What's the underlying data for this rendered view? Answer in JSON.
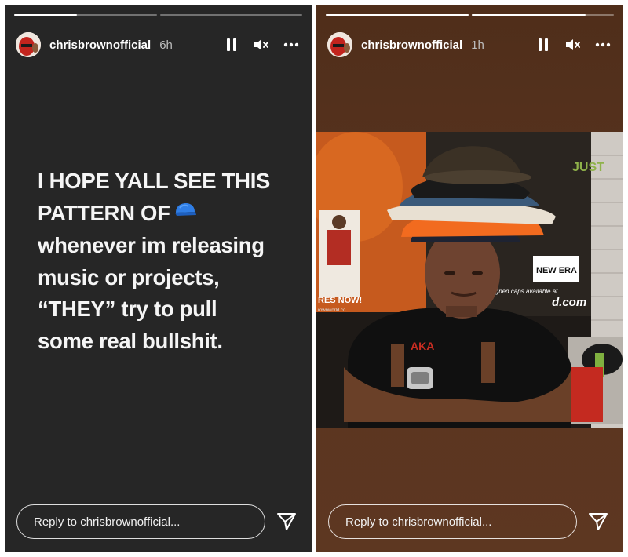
{
  "stories": [
    {
      "progress": [
        0.44,
        0.0
      ],
      "username": "chrisbrownofficial",
      "time_ago": "6h",
      "controls": {
        "pause_icon": "pause-icon",
        "mute_icon": "speaker-muted-icon",
        "more_icon": "more-horizontal-icon"
      },
      "text_lines": [
        "I HOPE YALL SEE THIS",
        "PATTERN OF",
        "whenever im releasing",
        "music or projects,",
        "“THEY” try to pull",
        "some real bullshit."
      ],
      "emoji": "blue-cap-emoji",
      "reply_placeholder": "Reply to chrisbrownofficial...",
      "send_icon": "paper-plane-icon"
    },
    {
      "progress": [
        1.0,
        0.8
      ],
      "username": "chrisbrownofficial",
      "time_ago": "1h",
      "controls": {
        "pause_icon": "pause-icon",
        "mute_icon": "speaker-muted-icon",
        "more_icon": "more-horizontal-icon"
      },
      "photo": {
        "description_icon": "photo",
        "poster_text_left": "RES NOW!",
        "poster_text_left_small": "rownworld.co",
        "poster_text_right_small": "signed caps available at",
        "poster_text_right": "d.com",
        "logo_text": "NEW ERA",
        "corner_logo": "JUST"
      },
      "reply_placeholder": "Reply to chrisbrownofficial...",
      "send_icon": "paper-plane-icon"
    }
  ],
  "colors": {
    "left_bg": "#262626",
    "right_bg": "#5b3420",
    "text": "#ffffff"
  }
}
